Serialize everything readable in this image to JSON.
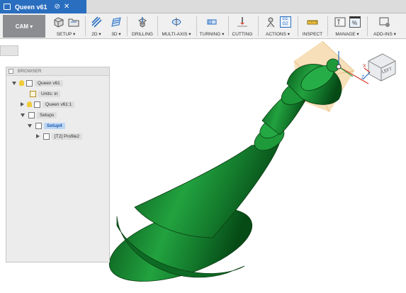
{
  "window": {
    "doc_title": "Queen v61",
    "tab_separator": "⊘",
    "tab_close": "✕"
  },
  "ribbon": {
    "workspace": "CAM ▾",
    "groups": [
      {
        "label": "SETUP ▾"
      },
      {
        "label": "2D ▾"
      },
      {
        "label": "3D ▾"
      },
      {
        "label": "DRILLING"
      },
      {
        "label": "MULTI-AXIS ▾"
      },
      {
        "label": "TURNING ▾"
      },
      {
        "label": "CUTTING"
      },
      {
        "label": "ACTIONS ▾"
      },
      {
        "label": "INSPECT"
      },
      {
        "label": "MANAGE ▾"
      },
      {
        "label": "ADD-INS ▾"
      }
    ],
    "actions_icon_text": [
      "G1",
      "G2"
    ],
    "manage_icon_text": "%"
  },
  "browser": {
    "title": "BROWSER",
    "nodes": {
      "root": "Queen v61",
      "units": "Units: in",
      "component": "Queen v61:1",
      "setups": "Setups",
      "setup4": "Setup4",
      "profile": "[T2] Profile2"
    }
  },
  "viewcube": {
    "face": "LEFT",
    "axes": [
      "Z",
      "X"
    ]
  },
  "colors": {
    "accent": "#2a6ebf",
    "model": "#1a9a3a",
    "stock": "#f0c580"
  }
}
